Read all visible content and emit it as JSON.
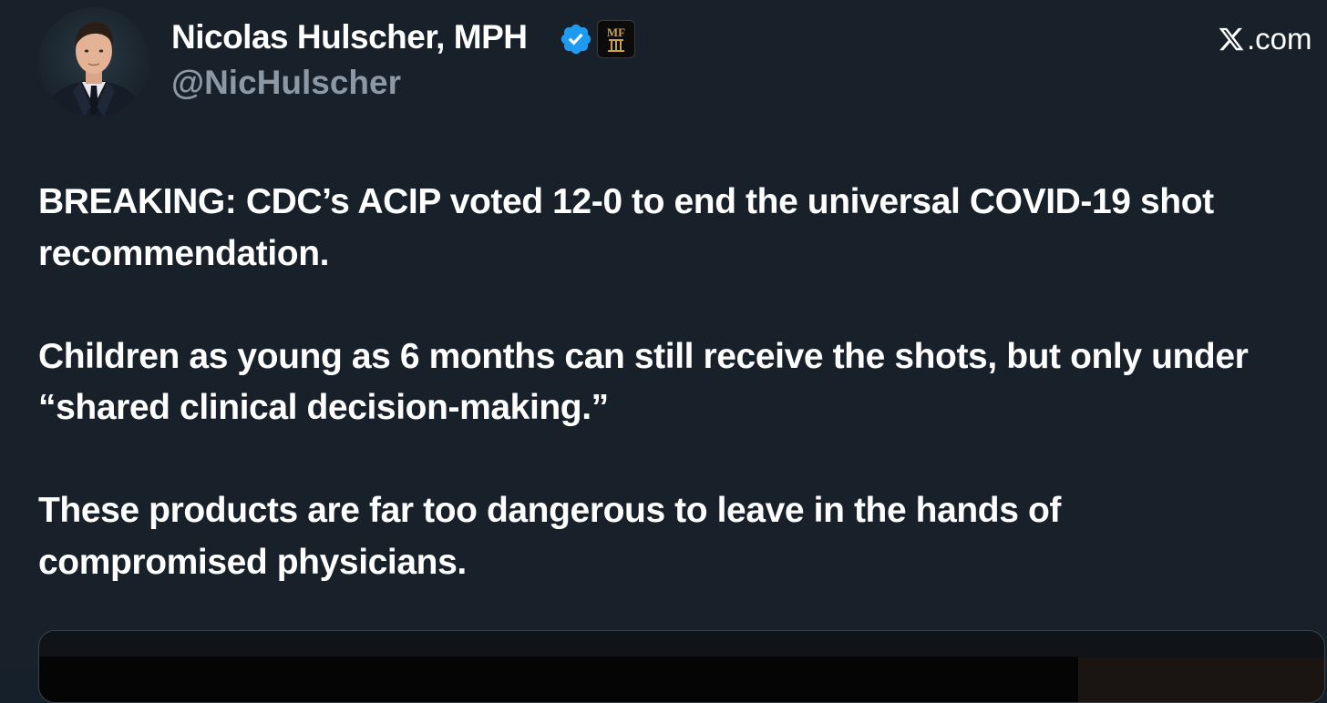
{
  "author": {
    "name": "Nicolas Hulscher, MPH",
    "handle": "@NicHulscher",
    "verified": true,
    "verified_color": "#1d9bf0",
    "affiliate_badge": "MF"
  },
  "brand": {
    "logo_text": ".com",
    "icon": "x-logo-icon"
  },
  "tweet": {
    "paragraphs": [
      "BREAKING: CDC’s ACIP voted 12-0 to end the universal COVID-19 shot recommendation.",
      "Children as young as 6 months can still receive the shots, but only under “shared clinical decision-making.”",
      "These products are far too dangerous to leave in the hands of compromised physicians."
    ]
  },
  "colors": {
    "background": "#18202a",
    "text": "#ffffff",
    "secondary_text": "#8b98a5"
  }
}
